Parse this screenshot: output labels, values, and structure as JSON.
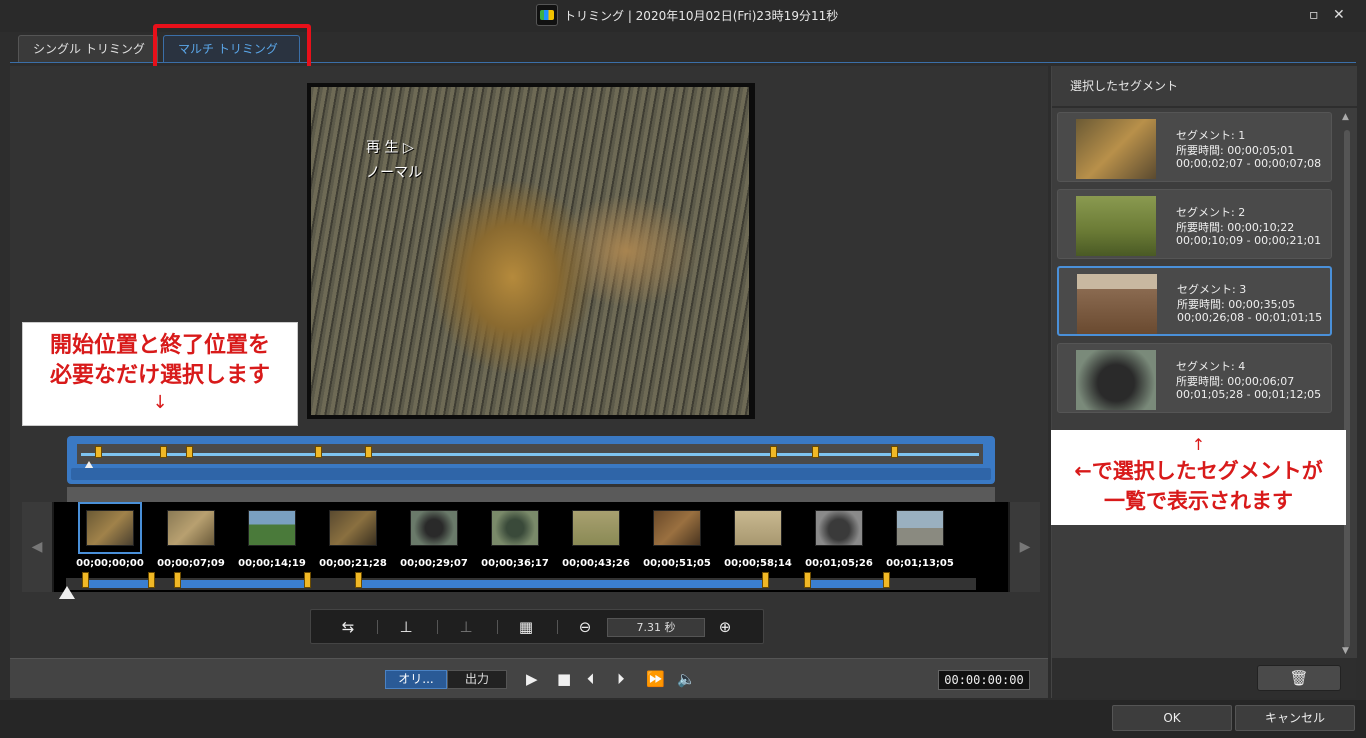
{
  "window": {
    "title": "トリミング | 2020年10月02日(Fri)23時19分11秒",
    "restore_icon": "restore-icon",
    "close_icon": "close-icon"
  },
  "tabs": [
    {
      "label": "シングル トリミング",
      "active": false
    },
    {
      "label": "マルチ トリミング",
      "active": true
    }
  ],
  "video": {
    "overlay_line1": "再 生 ▷",
    "overlay_line2": "ノーマル"
  },
  "callout_left": {
    "line1": "開始位置と終了位置を",
    "line2": "必要なだけ選択します",
    "arrow": "↓"
  },
  "filmstrip": {
    "times": [
      "00;00;00;00",
      "00;00;07;09",
      "00;00;14;19",
      "00;00;21;28",
      "00;00;29;07",
      "00;00;36;17",
      "00;00;43;26",
      "00;00;51;05",
      "00;00;58;14",
      "00;01;05;26",
      "00;01;13;05"
    ],
    "prev_icon": "chevron-left-icon",
    "next_icon": "chevron-right-icon"
  },
  "toolbar": {
    "zoom_value": "7.31 秒"
  },
  "playback": {
    "mode_original": "オリ...",
    "mode_output": "出力",
    "timecode": "00:00:00:00"
  },
  "right_panel": {
    "header": "選択したセグメント",
    "segments": [
      {
        "name": "セグメント: 1",
        "duration": "所要時間: 00;00;05;01",
        "range": "00;00;02;07 - 00;00;07;08"
      },
      {
        "name": "セグメント: 2",
        "duration": "所要時間: 00;00;10;22",
        "range": "00;00;10;09 - 00;00;21;01"
      },
      {
        "name": "セグメント: 3",
        "duration": "所要時間: 00;00;35;05",
        "range": "00;00;26;08 - 00;01;01;15"
      },
      {
        "name": "セグメント: 4",
        "duration": "所要時間: 00;00;06;07",
        "range": "00;01;05;28 - 00;01;12;05"
      }
    ]
  },
  "callout_right": {
    "arrow": "↑",
    "line1": "←で選択したセグメントが",
    "line2": "一覧で表示されます"
  },
  "buttons": {
    "ok": "OK",
    "cancel": "キャンセル"
  },
  "colors": {
    "accent": "#3a79c4",
    "callout_red": "#d81a1a",
    "marker": "#f0b826"
  }
}
